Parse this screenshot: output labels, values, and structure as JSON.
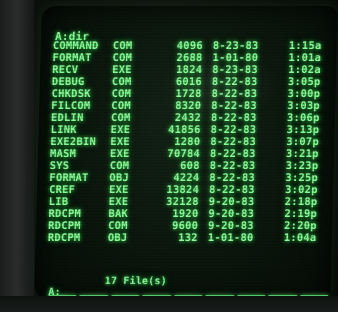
{
  "screen": {
    "prompt": "A:dir",
    "files": [
      {
        "name": "COMMAND",
        "ext": "COM",
        "size": "4096",
        "date": "8-23-83",
        "time": "1:15a"
      },
      {
        "name": "FORMAT",
        "ext": "COM",
        "size": "2688",
        "date": "1-01-80",
        "time": "1:01a"
      },
      {
        "name": "RECV",
        "ext": "EXE",
        "size": "1824",
        "date": "8-23-83",
        "time": "1:02a"
      },
      {
        "name": "DEBUG",
        "ext": "COM",
        "size": "6016",
        "date": "8-22-83",
        "time": "3:05p"
      },
      {
        "name": "CHKDSK",
        "ext": "COM",
        "size": "1728",
        "date": "8-22-83",
        "time": "3:00p"
      },
      {
        "name": "FILCOM",
        "ext": "COM",
        "size": "8320",
        "date": "8-22-83",
        "time": "3:03p"
      },
      {
        "name": "EDLIN",
        "ext": "COM",
        "size": "2432",
        "date": "8-22-83",
        "time": "3:06p"
      },
      {
        "name": "LINK",
        "ext": "EXE",
        "size": "41856",
        "date": "8-22-83",
        "time": "3:13p"
      },
      {
        "name": "EXE2BIN",
        "ext": "EXE",
        "size": "1280",
        "date": "8-22-83",
        "time": "3:07p"
      },
      {
        "name": "MASM",
        "ext": "EXE",
        "size": "70784",
        "date": "8-22-83",
        "time": "3:21p"
      },
      {
        "name": "SYS",
        "ext": "COM",
        "size": "608",
        "date": "8-22-83",
        "time": "3:23p"
      },
      {
        "name": "FORMAT",
        "ext": "OBJ",
        "size": "4224",
        "date": "8-22-83",
        "time": "3:25p"
      },
      {
        "name": "CREF",
        "ext": "EXE",
        "size": "13824",
        "date": "8-22-83",
        "time": "3:02p"
      },
      {
        "name": "LIB",
        "ext": "EXE",
        "size": "32128",
        "date": "9-20-83",
        "time": "2:18p"
      },
      {
        "name": "RDCPM",
        "ext": "BAK",
        "size": "1920",
        "date": "9-20-83",
        "time": "2:19p"
      },
      {
        "name": "RDCPM",
        "ext": "COM",
        "size": "9600",
        "date": "9-20-83",
        "time": "2:20p"
      },
      {
        "name": "RDCPM",
        "ext": "OBJ",
        "size": "132",
        "date": "1-01-80",
        "time": "1:04a"
      }
    ],
    "summary": "17 File(s)",
    "prompt2": "A:_",
    "fkeys": [
      "",
      "",
      "",
      "",
      "",
      "",
      "",
      "",
      ""
    ]
  },
  "colors": {
    "phosphor": "#8ef79a",
    "glow": "#39d553",
    "fkey_bar": "#5fe27a"
  }
}
